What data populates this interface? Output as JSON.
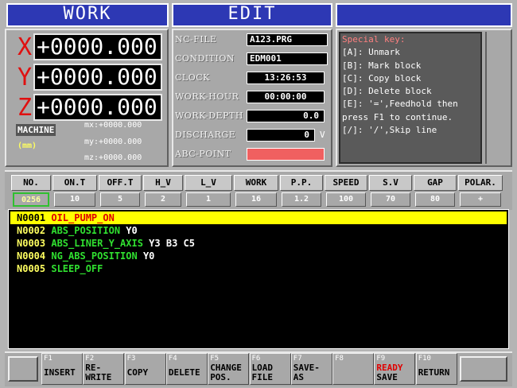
{
  "titles": {
    "work": "WORK",
    "edit": "EDIT",
    "blank": ""
  },
  "axes": [
    {
      "letter": "X",
      "value": "+0000.000"
    },
    {
      "letter": "Y",
      "value": "+0000.000"
    },
    {
      "letter": "Z",
      "value": "+0000.000"
    }
  ],
  "machine": {
    "label": "MACHINE",
    "unit": "(mm)",
    "mx": "mx:+0000.000",
    "my": "my:+0000.000",
    "mz": "mz:+0000.000"
  },
  "info": {
    "nc_file_label": "NC-FILE",
    "nc_file": "A123.PRG",
    "condition_label": "CONDITION",
    "condition": "EDM001",
    "clock_label": "CLOCK",
    "clock": "13:26:53",
    "work_hour_label": "WORK-HOUR",
    "work_hour": "00:00:00",
    "work_depth_label": "WORK-DEPTH",
    "work_depth": "0.0",
    "discharge_label": "DISCHARGE",
    "discharge": "0",
    "discharge_unit": "V",
    "abc_point_label": "ABC-POINT"
  },
  "special": {
    "heading": "Special key:",
    "lines": [
      "[A]: Unmark",
      "[B]: Mark block",
      "[C]: Copy block",
      "[D]: Delete block",
      "[E]: '=',Feedhold then",
      "press F1 to continue.",
      "[/]: '/',Skip line"
    ]
  },
  "params": {
    "headers": [
      "NO.",
      "ON.T",
      "OFF.T",
      "H_V",
      "L_V",
      "WORK",
      "P.P.",
      "SPEED",
      "S.V",
      "GAP",
      "POLAR."
    ],
    "values": [
      "0256",
      "10",
      "5",
      "2",
      "1",
      "16",
      "1.2",
      "100",
      "70",
      "80",
      "+"
    ]
  },
  "program": [
    {
      "n": "N0001",
      "cmd": "OIL_PUMP_ON",
      "args": ""
    },
    {
      "n": "N0002",
      "cmd": "ABS_POSITION",
      "args": " Y0"
    },
    {
      "n": "N0003",
      "cmd": "ABS_LINER_Y_AXIS",
      "args": " Y3 B3 C5"
    },
    {
      "n": "N0004",
      "cmd": "NG_ABS_POSITION",
      "args": " Y0"
    },
    {
      "n": "N0005",
      "cmd": "SLEEP_OFF",
      "args": ""
    }
  ],
  "fkeys": [
    {
      "num": "F1",
      "label": "INSERT"
    },
    {
      "num": "F2",
      "label": "RE-\nWRITE"
    },
    {
      "num": "F3",
      "label": "COPY"
    },
    {
      "num": "F4",
      "label": "DELETE"
    },
    {
      "num": "F5",
      "label": "CHANGE\nPOS."
    },
    {
      "num": "F6",
      "label": "LOAD\nFILE"
    },
    {
      "num": "F7",
      "label": "SAVE-\nAS"
    },
    {
      "num": "F8",
      "label": ""
    },
    {
      "num": "F9",
      "label_red": "READY",
      "label": "SAVE"
    },
    {
      "num": "F10",
      "label": "RETURN"
    }
  ],
  "colors": {
    "title_bg": "#2d38b4",
    "axis_letter": "#e01010",
    "highlight": "#ffff00",
    "abc_point": "#f06060"
  }
}
